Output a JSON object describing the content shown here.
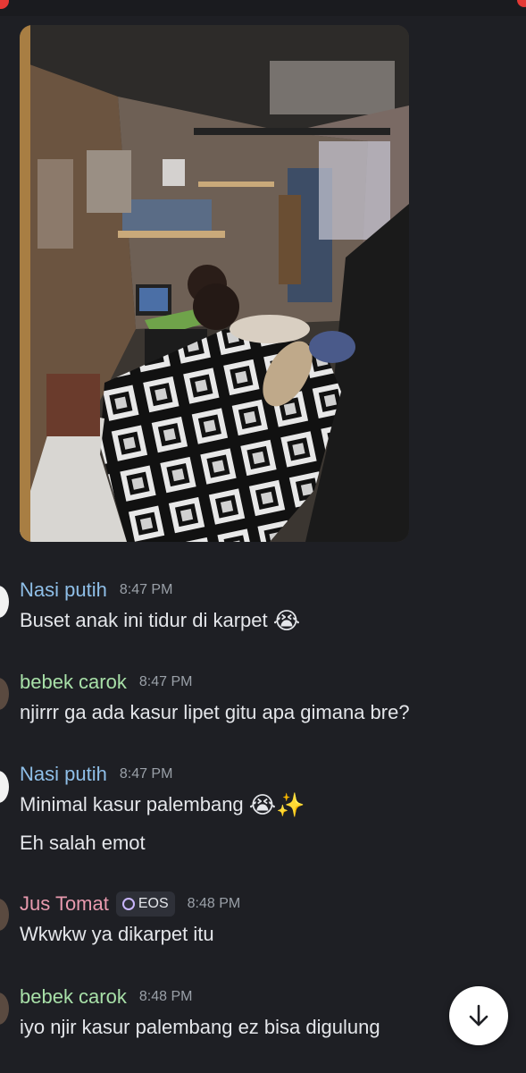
{
  "colors": {
    "background": "#1e1f24",
    "name_nasi": "#8fbfe8",
    "name_bebek": "#a8e0a8",
    "name_jus": "#e89aae",
    "timestamp": "#9aa0a8"
  },
  "attachment": {
    "icon": "photo-attachment",
    "description_hidden": true
  },
  "messages": [
    {
      "author": "Nasi putih",
      "time": "8:47 PM",
      "lines": [
        "Buset anak ini tidur di karpet"
      ],
      "emoji": "😭"
    },
    {
      "author": "bebek carok",
      "time": "8:47 PM",
      "lines": [
        "njirrr ga ada kasur lipet gitu apa gimana bre?"
      ]
    },
    {
      "author": "Nasi putih",
      "time": "8:47 PM",
      "lines": [
        "Minimal kasur palembang",
        "Eh salah emot"
      ],
      "emoji": "😭✨"
    },
    {
      "author": "Jus Tomat",
      "tag": "EOS",
      "time": "8:48 PM",
      "lines": [
        "Wkwkw ya dikarpet itu"
      ]
    },
    {
      "author": "bebek carok",
      "time": "8:48 PM",
      "lines": [
        "iyo njir kasur palembang ez bisa digulung"
      ]
    }
  ],
  "scroll_button": {
    "icon": "arrow-down-icon"
  }
}
